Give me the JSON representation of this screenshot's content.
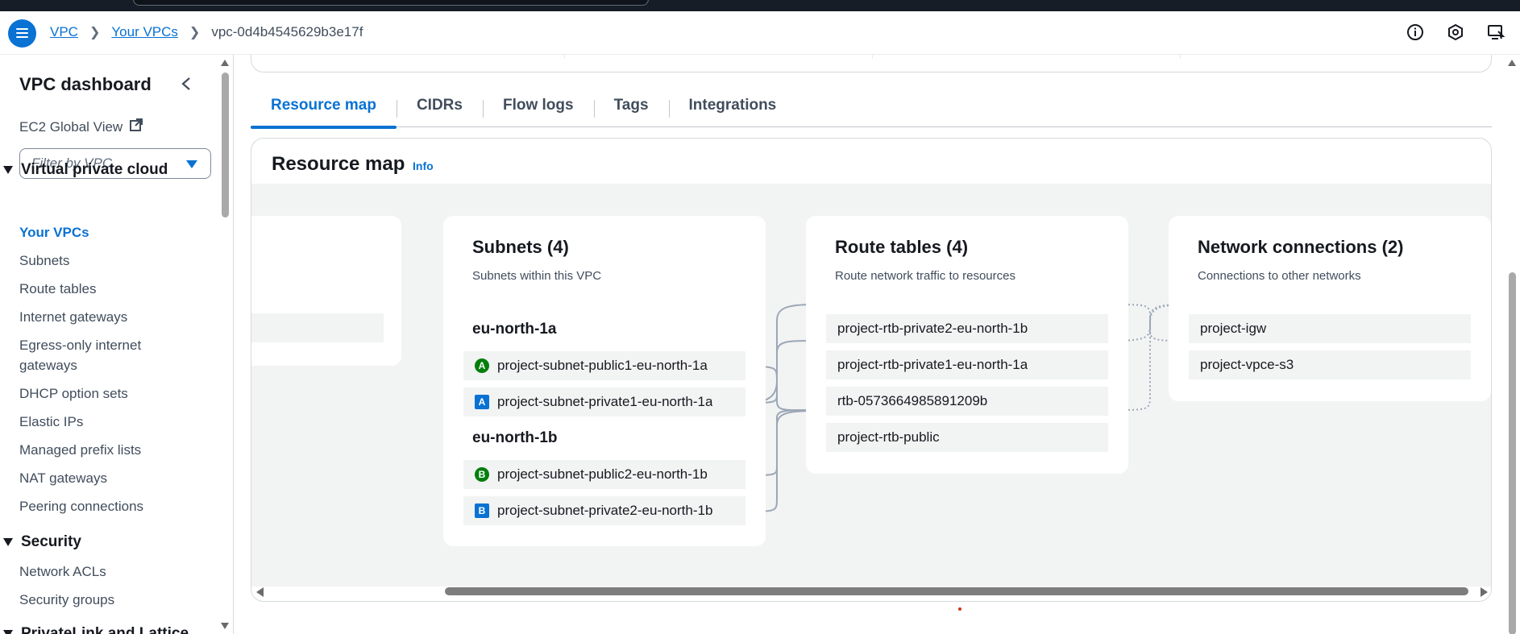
{
  "breadcrumb": {
    "items": [
      "VPC",
      "Your VPCs"
    ],
    "current": "vpc-0d4b4545629b3e17f"
  },
  "sidebar": {
    "title": "VPC dashboard",
    "global_view": "EC2 Global View",
    "filter_placeholder": "Filter by VPC",
    "section_vpc": "Virtual private cloud",
    "vpc_items": [
      "Your VPCs",
      "Subnets",
      "Route tables",
      "Internet gateways",
      "Egress-only internet gateways",
      "DHCP option sets",
      "Elastic IPs",
      "Managed prefix lists",
      "NAT gateways",
      "Peering connections"
    ],
    "section_security": "Security",
    "security_items": [
      "Network ACLs",
      "Security groups"
    ],
    "section_next": "PrivateLink and Lattice"
  },
  "tabs": [
    "Resource map",
    "CIDRs",
    "Flow logs",
    "Tags",
    "Integrations"
  ],
  "resource_map": {
    "title": "Resource map",
    "info": "Info",
    "subnets": {
      "title": "Subnets (4)",
      "desc": "Subnets within this VPC",
      "az1": "eu-north-1a",
      "az2": "eu-north-1b",
      "items": [
        {
          "badge": "A",
          "kind": "pub",
          "name": "project-subnet-public1-eu-north-1a"
        },
        {
          "badge": "A",
          "kind": "priv",
          "name": "project-subnet-private1-eu-north-1a"
        },
        {
          "badge": "B",
          "kind": "pub",
          "name": "project-subnet-public2-eu-north-1b"
        },
        {
          "badge": "B",
          "kind": "priv",
          "name": "project-subnet-private2-eu-north-1b"
        }
      ]
    },
    "route_tables": {
      "title": "Route tables (4)",
      "desc": "Route network traffic to resources",
      "items": [
        "project-rtb-private2-eu-north-1b",
        "project-rtb-private1-eu-north-1a",
        "rtb-0573664985891209b",
        "project-rtb-public"
      ]
    },
    "network_connections": {
      "title": "Network connections (2)",
      "desc": "Connections to other networks",
      "items": [
        "project-igw",
        "project-vpce-s3"
      ]
    }
  },
  "colors": {
    "accent": "#0972d3",
    "public_badge": "#037f0c",
    "private_badge": "#0972d3"
  }
}
